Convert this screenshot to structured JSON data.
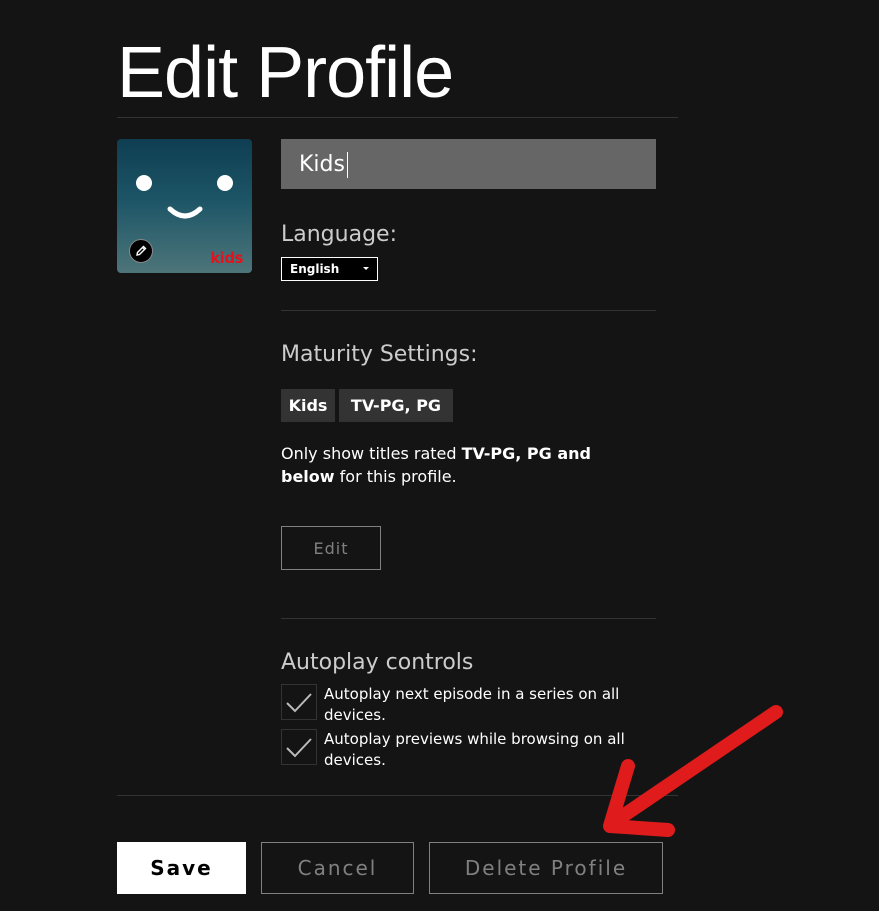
{
  "header": {
    "title": "Edit Profile"
  },
  "profile": {
    "avatar_badge": "kids",
    "name_value": "Kids"
  },
  "language": {
    "label": "Language:",
    "selected": "English"
  },
  "maturity": {
    "label": "Maturity Settings:",
    "tags": [
      "Kids",
      "TV-PG, PG"
    ],
    "desc_prefix": "Only show titles rated ",
    "desc_bold1": "TV-PG, PG and",
    "desc_bold2": "below",
    "desc_suffix": " for this profile.",
    "edit_label": "Edit"
  },
  "autoplay": {
    "label": "Autoplay controls",
    "options": [
      {
        "text": "Autoplay next episode in a series on all devices.",
        "checked": true
      },
      {
        "text": "Autoplay previews while browsing on all devices.",
        "checked": true
      }
    ]
  },
  "actions": {
    "save": "Save",
    "cancel": "Cancel",
    "delete": "Delete Profile"
  },
  "colors": {
    "background": "#141414",
    "annotation_arrow": "#e01b1b",
    "kids_badge": "#e8101a"
  },
  "icons": {
    "avatar_edit": "pencil-icon",
    "check": "checkmark-icon",
    "dropdown": "caret-down-icon",
    "annotation": "red-arrow-icon"
  }
}
